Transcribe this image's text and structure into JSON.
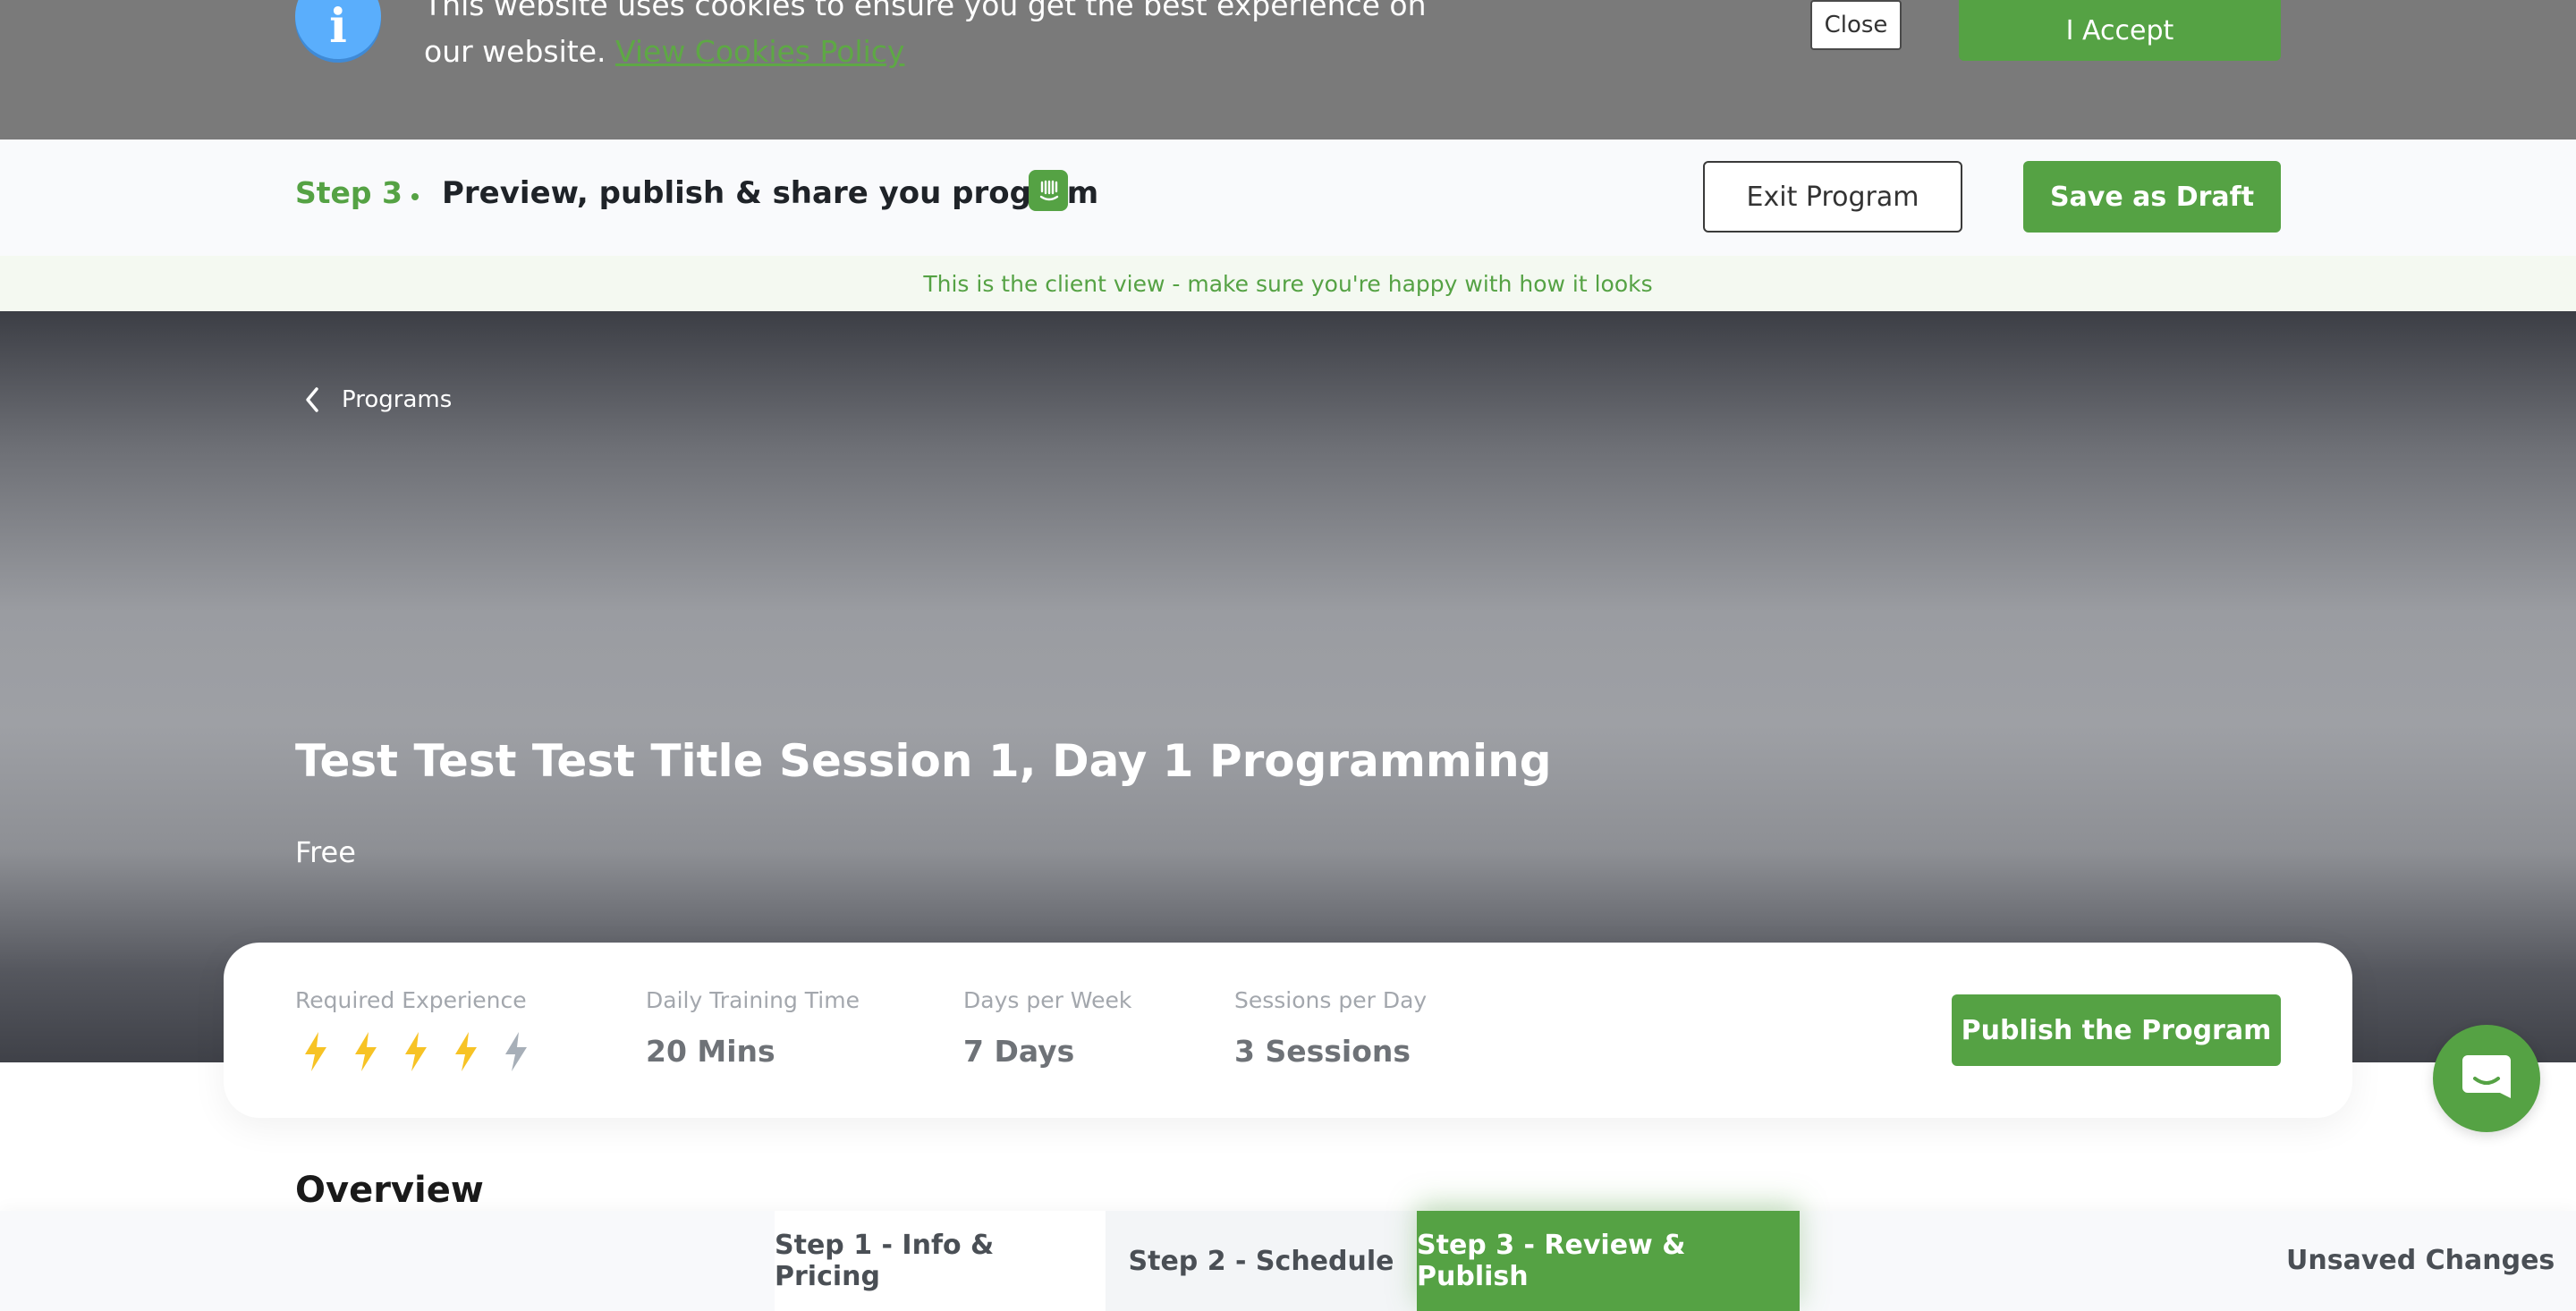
{
  "cookie_banner": {
    "text": "This website uses cookies to ensure you get the best experience on our website.",
    "link_label": "View Cookies Policy",
    "close_label": "Close",
    "accept_label": "I Accept",
    "info_glyph": "i"
  },
  "header": {
    "step_label": "Step 3",
    "step_title": "Preview, publish & share you program",
    "exit_label": "Exit Program",
    "draft_label": "Save as Draft"
  },
  "client_note": "This is the client view - make sure you're happy with how it looks",
  "hero": {
    "back_label": "Programs",
    "title": "Test Test Test Title Session 1, Day 1 Programming",
    "price": "Free"
  },
  "stats": {
    "experience_label": "Required Experience",
    "experience_level": 4,
    "experience_max": 5,
    "training_time_label": "Daily Training Time",
    "training_time_value": "20 Mins",
    "days_label": "Days per Week",
    "days_value": "7 Days",
    "sessions_label": "Sessions per Day",
    "sessions_value": "3 Sessions",
    "publish_label": "Publish the Program"
  },
  "overview_heading": "Overview",
  "bottom_tabs": [
    {
      "label": "Step 1 - Info & Pricing",
      "active": false
    },
    {
      "label": "Step 2 - Schedule",
      "active": false
    },
    {
      "label": "Step 3 - Review & Publish",
      "active": true
    }
  ],
  "unsaved_label": "Unsaved Changes",
  "colors": {
    "accent": "#55a244",
    "bolt_active": "#f7c325",
    "bolt_inactive": "#a7afb8",
    "info_blue": "#5aaefc"
  },
  "icons": [
    "info-icon",
    "intercom-icon",
    "chevron-left-icon",
    "lightning-bolt-icon",
    "chat-icon"
  ]
}
